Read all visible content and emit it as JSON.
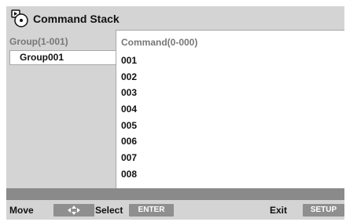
{
  "title": "Command Stack",
  "icons": {
    "app": "command-stack-icon",
    "move_key": "dpad-arrows-icon"
  },
  "group_panel": {
    "header": "Group(1-001)",
    "items": [
      "Group001"
    ]
  },
  "command_panel": {
    "header": "Command(0-000)",
    "items": [
      "001",
      "002",
      "003",
      "004",
      "005",
      "006",
      "007",
      "008"
    ]
  },
  "footer": {
    "move_label": "Move",
    "select_label": "Select",
    "select_key": "ENTER",
    "exit_label": "Exit",
    "exit_key": "SETUP"
  },
  "colors": {
    "panel_bg": "#d4d4d4",
    "list_bg": "#ffffff",
    "status_bar": "#8a8a8a",
    "key_badge": "#8f8f8f"
  }
}
